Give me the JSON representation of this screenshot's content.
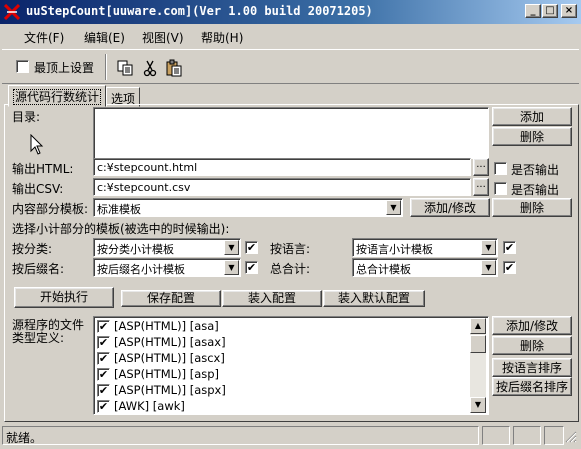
{
  "window": {
    "title": "uuStepCount[uuware.com](Ver 1.00 build 20071205)",
    "minimize": "_",
    "maximize": "□",
    "close": "×"
  },
  "menu": [
    "文件(F)",
    "编辑(E)",
    "视图(V)",
    "帮助(H)"
  ],
  "toolbar": {
    "topmost_label": "最顶上设置",
    "topmost_checked": false
  },
  "tabs": [
    "源代码行数统计",
    "选项"
  ],
  "form": {
    "dir_label": "目录:",
    "add_button": "添加",
    "delete_button": "删除",
    "output_html_label": "输出HTML:",
    "output_html_value": "c:¥stepcount.html",
    "output_csv_label": "输出CSV:",
    "output_csv_value": "c:¥stepcount.csv",
    "browse": "...",
    "export_label": "是否输出",
    "content_template_label": "内容部分模板:",
    "content_template_value": "标准模板",
    "add_edit_button": "添加/修改",
    "template_delete_button": "删除",
    "subtotal_heading": "选择小计部分的模板(被选中的时候输出):",
    "by_category_label": "按分类:",
    "by_category_value": "按分类小计模板",
    "by_language_label": "按语言:",
    "by_language_value": "按语言小计模板",
    "by_ext_label": "按后缀名:",
    "by_ext_value": "按后缀名小计模板",
    "total_label": "总合计:",
    "total_value": "总合计模板",
    "start_button": "开始执行",
    "save_config_button": "保存配置",
    "load_config_button": "装入配置",
    "load_default_button": "装入默认配置",
    "filetype_label_line1": "源程序的文件",
    "filetype_label_line2": "类型定义:",
    "filetypes": [
      "[ASP(HTML)] [asa]",
      "[ASP(HTML)] [asax]",
      "[ASP(HTML)] [ascx]",
      "[ASP(HTML)] [asp]",
      "[ASP(HTML)] [aspx]",
      "[AWK] [awk]"
    ],
    "filetype_add_edit_button": "添加/修改",
    "filetype_delete_button": "删除",
    "sort_by_language_button": "按语言排序",
    "sort_by_ext_button": "按后缀名排序"
  },
  "status": {
    "text": "就绪。"
  }
}
